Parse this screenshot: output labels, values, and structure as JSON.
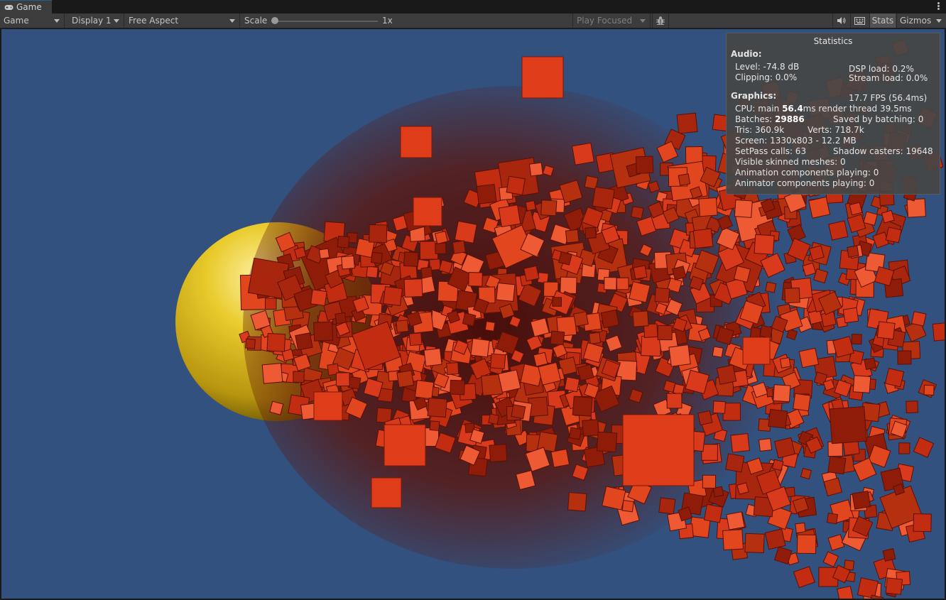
{
  "tab": {
    "icon": "gamepad-icon",
    "label": "Game"
  },
  "toolbar": {
    "mode": "Game",
    "display": "Display 1",
    "aspect": "Free Aspect",
    "scale_label": "Scale",
    "scale_value": "1x",
    "play_focused": "Play Focused",
    "stats_label": "Stats",
    "gizmos_label": "Gizmos"
  },
  "stats": {
    "title": "Statistics",
    "audio_header": "Audio:",
    "audio_level": "Level: -74.8 dB",
    "audio_clipping": "Clipping: 0.0%",
    "dsp_load": "DSP load: 0.2%",
    "stream_load": "Stream load: 0.0%",
    "graphics_header": "Graphics:",
    "fps": "17.7 FPS (56.4ms)",
    "cpu_prefix": "CPU: main ",
    "cpu_main": "56.4",
    "cpu_suffix": "ms  render thread 39.5ms",
    "batches_prefix": "Batches: ",
    "batches_value": "29886",
    "saved_by_batching": "Saved by batching: 0",
    "tris": "Tris: 360.9k",
    "verts": "Verts: 718.7k",
    "screen": "Screen: 1330x803 - 12.2 MB",
    "setpass": "SetPass calls: 63",
    "shadow_casters": "Shadow casters: 19648",
    "skinned": "Visible skinned meshes: 0",
    "animation": "Animation components playing: 0",
    "animator": "Animator components playing: 0"
  },
  "scene": {
    "background": "#33517e",
    "sphere_color": "#e0c020",
    "cube_color": "#d93a1c",
    "cube_shadow": "#6e1408"
  }
}
